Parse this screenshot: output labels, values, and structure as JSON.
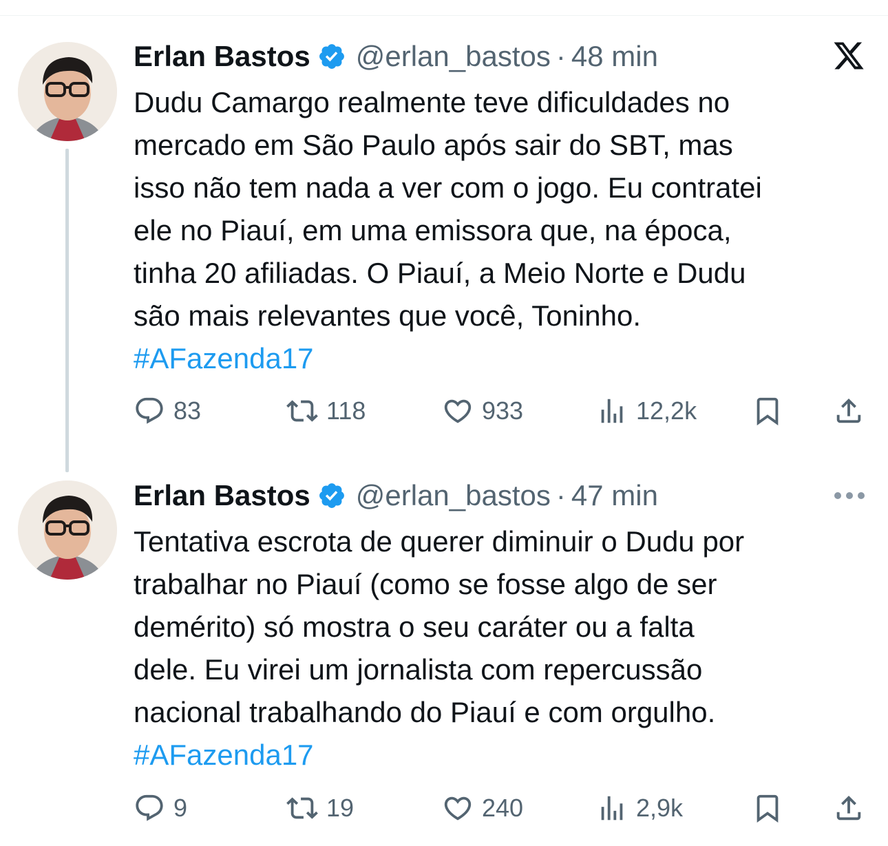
{
  "tweets": [
    {
      "author": "Erlan Bastos",
      "handle": "@erlan_bastos",
      "separator": "·",
      "time": "48 min",
      "text": "Dudu Camargo realmente teve dificuldades no\nmercado em São Paulo após sair do SBT, mas\nisso não tem nada a ver com o jogo. Eu contratei\nele no Piauí, em uma emissora que, na época,\ntinha 20 afiliadas. O Piauí, a Meio Norte e Dudu\nsão mais relevantes que você, Toninho.",
      "hashtag": "#AFazenda17",
      "replies": "83",
      "reposts": "118",
      "likes": "933",
      "views": "12,2k"
    },
    {
      "author": "Erlan Bastos",
      "handle": "@erlan_bastos",
      "separator": "·",
      "time": "47 min",
      "text": "Tentativa escrota de querer diminuir o Dudu por\ntrabalhar no Piauí (como se fosse algo de ser\ndemérito) só mostra o seu caráter ou a falta\ndele. Eu virei um jornalista com repercussão\nnacional trabalhando do Piauí e com orgulho.",
      "hashtag": "#AFazenda17",
      "replies": "9",
      "reposts": "19",
      "likes": "240",
      "views": "2,9k"
    }
  ],
  "icons": {
    "brand": "x-logo-icon",
    "verified": "verified-badge-icon",
    "reply": "reply-icon",
    "repost": "repost-icon",
    "like": "heart-icon",
    "views": "views-icon",
    "bookmark": "bookmark-icon",
    "share": "share-icon",
    "more": "more-icon"
  },
  "colors": {
    "link": "#1d9bf0",
    "verified": "#1d9bf0",
    "secondary_text": "#536471",
    "thread_line": "#cfd9de"
  }
}
